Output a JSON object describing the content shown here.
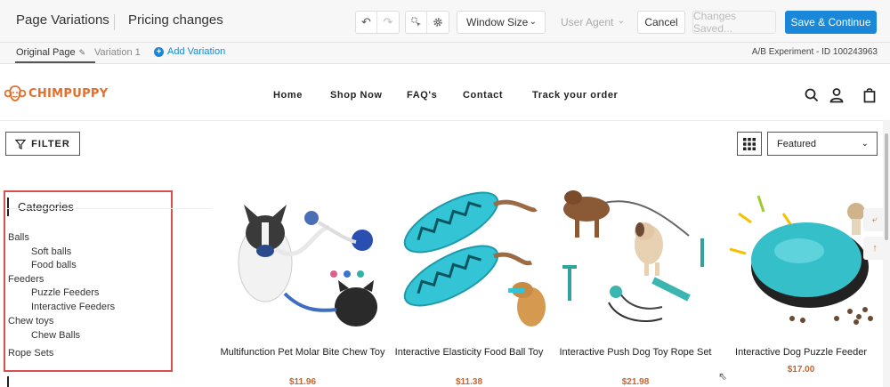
{
  "editor": {
    "page_title": "Page Variations",
    "section_title": "Pricing changes",
    "window_size_label": "Window Size",
    "user_agent_label": "User Agent",
    "cancel_label": "Cancel",
    "saved_status": "Changes Saved...",
    "save_label": "Save & Continue",
    "tabs": [
      "Original Page",
      "Variation 1"
    ],
    "add_variation_label": "Add Variation",
    "experiment_id": "A/B Experiment - ID 100243963",
    "accent_color": "#1a87d9"
  },
  "store": {
    "logo_text": "CHIMPUPPY",
    "brand_color": "#e46f2a",
    "nav": [
      "Home",
      "Shop Now",
      "FAQ's",
      "Contact",
      "Track your order"
    ],
    "filter_label": "FILTER",
    "sort_value": "Featured",
    "categories_title": "Categories",
    "categories": [
      {
        "label": "Balls",
        "level": 0
      },
      {
        "label": "Soft balls",
        "level": 1
      },
      {
        "label": "Food balls",
        "level": 1
      },
      {
        "label": "Feeders",
        "level": 0
      },
      {
        "label": "Puzzle Feeders",
        "level": 1
      },
      {
        "label": "Interactive Feeders",
        "level": 1
      },
      {
        "label": "Chew toys",
        "level": 0
      },
      {
        "label": "Chew Balls",
        "level": 1
      },
      {
        "label": "Rope Sets",
        "level": 0
      }
    ],
    "products": [
      {
        "name": "Multifunction Pet Molar Bite Chew Toy",
        "price": "$11.96"
      },
      {
        "name": "Interactive Elasticity Food Ball Toy",
        "price": "$11.38"
      },
      {
        "name": "Interactive Push Dog Toy Rope Set",
        "price": "$21.98"
      },
      {
        "name": "Interactive Dog Puzzle Feeder",
        "price": "$17.00"
      }
    ],
    "price_color": "#c8642c"
  }
}
